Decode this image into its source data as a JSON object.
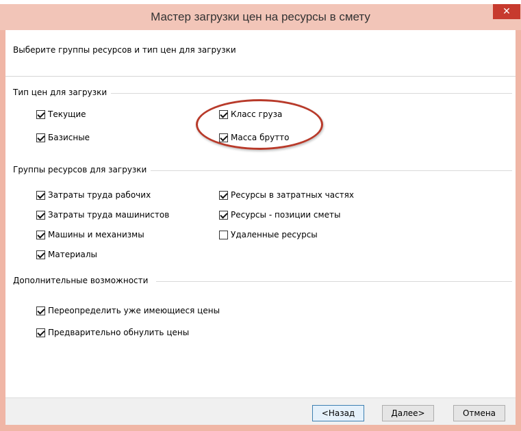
{
  "window": {
    "title": "Мастер загрузки цен на ресурсы в смету",
    "close_glyph": "✕"
  },
  "instruction": "Выберите группы ресурсов и тип цен для загрузки",
  "price_type_group": {
    "title": "Тип цен для загрузки",
    "options": [
      {
        "label": "Текущие",
        "checked": true
      },
      {
        "label": "Базисные",
        "checked": true
      },
      {
        "label": "Класс груза",
        "checked": true
      },
      {
        "label": "Масса брутто",
        "checked": true
      }
    ]
  },
  "resource_groups": {
    "title": "Группы ресурсов для загрузки",
    "options": [
      {
        "label": "Затраты труда рабочих",
        "checked": true
      },
      {
        "label": "Затраты труда машинистов",
        "checked": true
      },
      {
        "label": "Машины и механизмы",
        "checked": true
      },
      {
        "label": "Материалы",
        "checked": true
      },
      {
        "label": "Ресурсы в затратных частях",
        "checked": true
      },
      {
        "label": "Ресурсы - позиции сметы",
        "checked": true
      },
      {
        "label": "Удаленные ресурсы",
        "checked": false
      }
    ]
  },
  "extra_options": {
    "title": "Дополнительные возможности",
    "options": [
      {
        "label": "Переопределить уже имеющиеся цены",
        "checked": true
      },
      {
        "label": "Предварительно обнулить цены",
        "checked": true
      }
    ]
  },
  "buttons": {
    "back": "<Назад",
    "next": "Далее>",
    "cancel": "Отмена"
  },
  "colors": {
    "titlebar": "#f2c5b8",
    "close_button": "#c73a2e",
    "highlight_ellipse": "#b83a2a"
  }
}
